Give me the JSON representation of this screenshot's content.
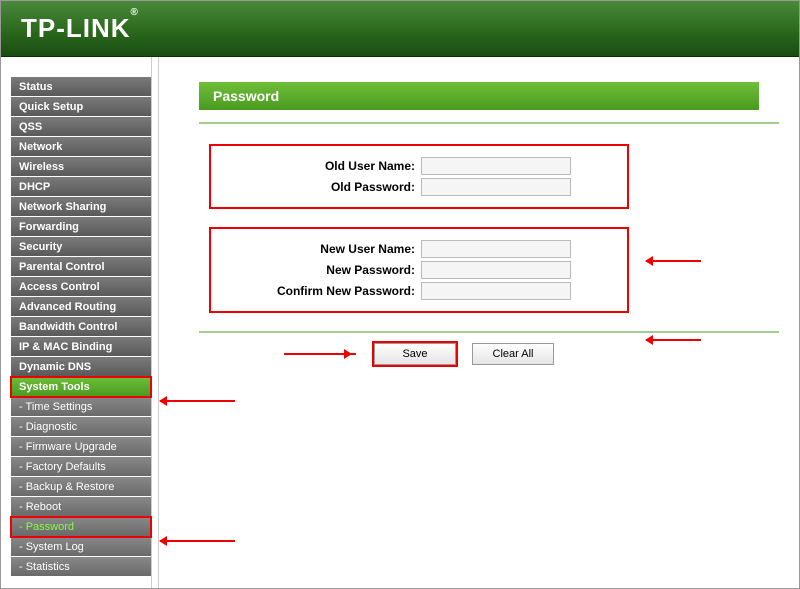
{
  "brand": "TP-LINK",
  "page_title": "Password",
  "sidebar": {
    "items": [
      {
        "label": "Status",
        "type": "top"
      },
      {
        "label": "Quick Setup",
        "type": "top"
      },
      {
        "label": "QSS",
        "type": "top"
      },
      {
        "label": "Network",
        "type": "top"
      },
      {
        "label": "Wireless",
        "type": "top"
      },
      {
        "label": "DHCP",
        "type": "top"
      },
      {
        "label": "Network Sharing",
        "type": "top"
      },
      {
        "label": "Forwarding",
        "type": "top"
      },
      {
        "label": "Security",
        "type": "top"
      },
      {
        "label": "Parental Control",
        "type": "top"
      },
      {
        "label": "Access Control",
        "type": "top"
      },
      {
        "label": "Advanced Routing",
        "type": "top"
      },
      {
        "label": "Bandwidth Control",
        "type": "top"
      },
      {
        "label": "IP & MAC Binding",
        "type": "top"
      },
      {
        "label": "Dynamic DNS",
        "type": "top"
      },
      {
        "label": "System Tools",
        "type": "top"
      },
      {
        "label": "- Time Settings",
        "type": "sub"
      },
      {
        "label": "- Diagnostic",
        "type": "sub"
      },
      {
        "label": "- Firmware Upgrade",
        "type": "sub"
      },
      {
        "label": "- Factory Defaults",
        "type": "sub"
      },
      {
        "label": "- Backup & Restore",
        "type": "sub"
      },
      {
        "label": "- Reboot",
        "type": "sub"
      },
      {
        "label": "- Password",
        "type": "sub"
      },
      {
        "label": "- System Log",
        "type": "sub"
      },
      {
        "label": "- Statistics",
        "type": "sub"
      }
    ]
  },
  "form": {
    "old_user_label": "Old User Name:",
    "old_pass_label": "Old Password:",
    "new_user_label": "New User Name:",
    "new_pass_label": "New Password:",
    "confirm_pass_label": "Confirm New Password:",
    "old_user_value": "",
    "old_pass_value": "",
    "new_user_value": "",
    "new_pass_value": "",
    "confirm_pass_value": ""
  },
  "buttons": {
    "save": "Save",
    "clear": "Clear All"
  }
}
